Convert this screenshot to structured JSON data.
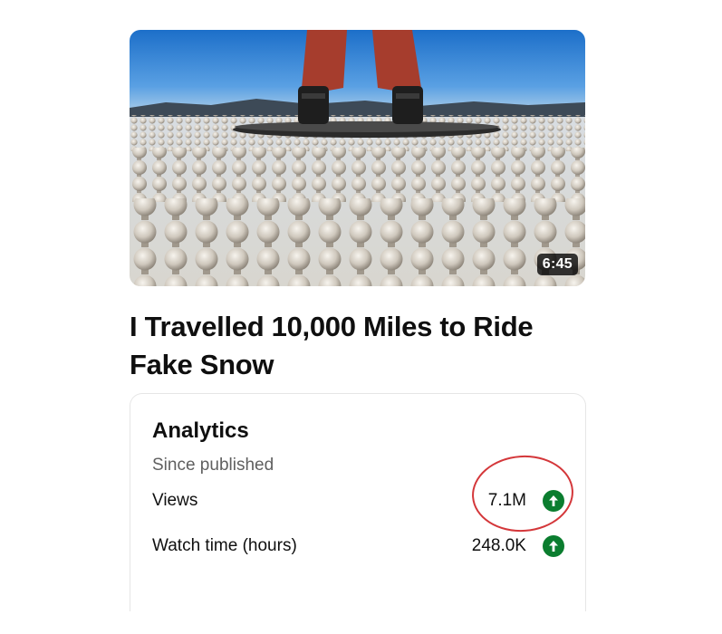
{
  "video": {
    "duration": "6:45",
    "title": "I Travelled 10,000 Miles to Ride Fake Snow"
  },
  "analytics": {
    "title": "Analytics",
    "subtitle": "Since published",
    "rows": [
      {
        "label": "Views",
        "value": "7.1M",
        "trend_icon": "arrow-up-circle-icon"
      },
      {
        "label": "Watch time (hours)",
        "value": "248.0K",
        "trend_icon": "arrow-up-circle-icon"
      }
    ]
  },
  "colors": {
    "trend_up": "#0b7d2f",
    "annotation": "#d4373a"
  }
}
